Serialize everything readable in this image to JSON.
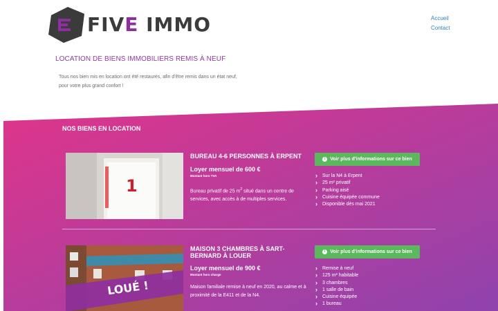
{
  "brand": {
    "name_part1": "FIV",
    "name_e": "E",
    "name_part2": "IMMO",
    "accent": "#8e2fa0",
    "dark": "#3b3b3b"
  },
  "nav": {
    "items": [
      "Accueil",
      "Contact"
    ]
  },
  "intro": {
    "title": "LOCATION DE BIENS IMMOBILIERS REMIS À NEUF",
    "line1": "Tous nos bien mis en location ont été restaurés, afin d'être remis dans un état neuf,",
    "line2": "pour votre plus grand confort !"
  },
  "section": {
    "title": "NOS BIENS EN LOCATION",
    "gradient_from": "#e0358a",
    "gradient_to": "#8f43ad"
  },
  "listings": [
    {
      "title": "BUREAU 4-6 PERSONNES À ERPENT",
      "price": "Loyer mensuel de 600 €",
      "price_note": "Montant hors TVA",
      "desc_a": "Bureau privatif de 25 m",
      "desc_sup": "2",
      "desc_b": " situé dans un centre de services, avec accès à de multiples services.",
      "button": "Voir plus d'informations sur ce bien",
      "features": [
        "Sur la N4 à Erpent",
        "25 m² privatif",
        "Parking aisé",
        "Cuisine équipée commune",
        "Disponible dès mai 2021"
      ],
      "photo_text": "1"
    },
    {
      "title": "MAISON 3 CHAMBRES À SART-BERNARD À LOUER",
      "price": "Loyer mensuel de 900 €",
      "price_note": "Montant hors charge",
      "desc": "Maison familiale remise à neuf en 2020, au calme et à proximité de la E411 et de la N4.",
      "button": "Voir plus d'informations sur ce bien",
      "features": [
        "Remise à neuf",
        "125 m² habitable",
        "3 chambres",
        "1 salle de bain",
        "Cuisine équipée",
        "1 bureau"
      ],
      "photo_text": "LOUÉ !"
    }
  ],
  "colors": {
    "button": "#5cb85c",
    "link": "#2f7fb7",
    "title_purple": "#8e3aa0"
  },
  "icons": {
    "info": "info-circle-icon",
    "bullet": "chevron-right-icon"
  }
}
